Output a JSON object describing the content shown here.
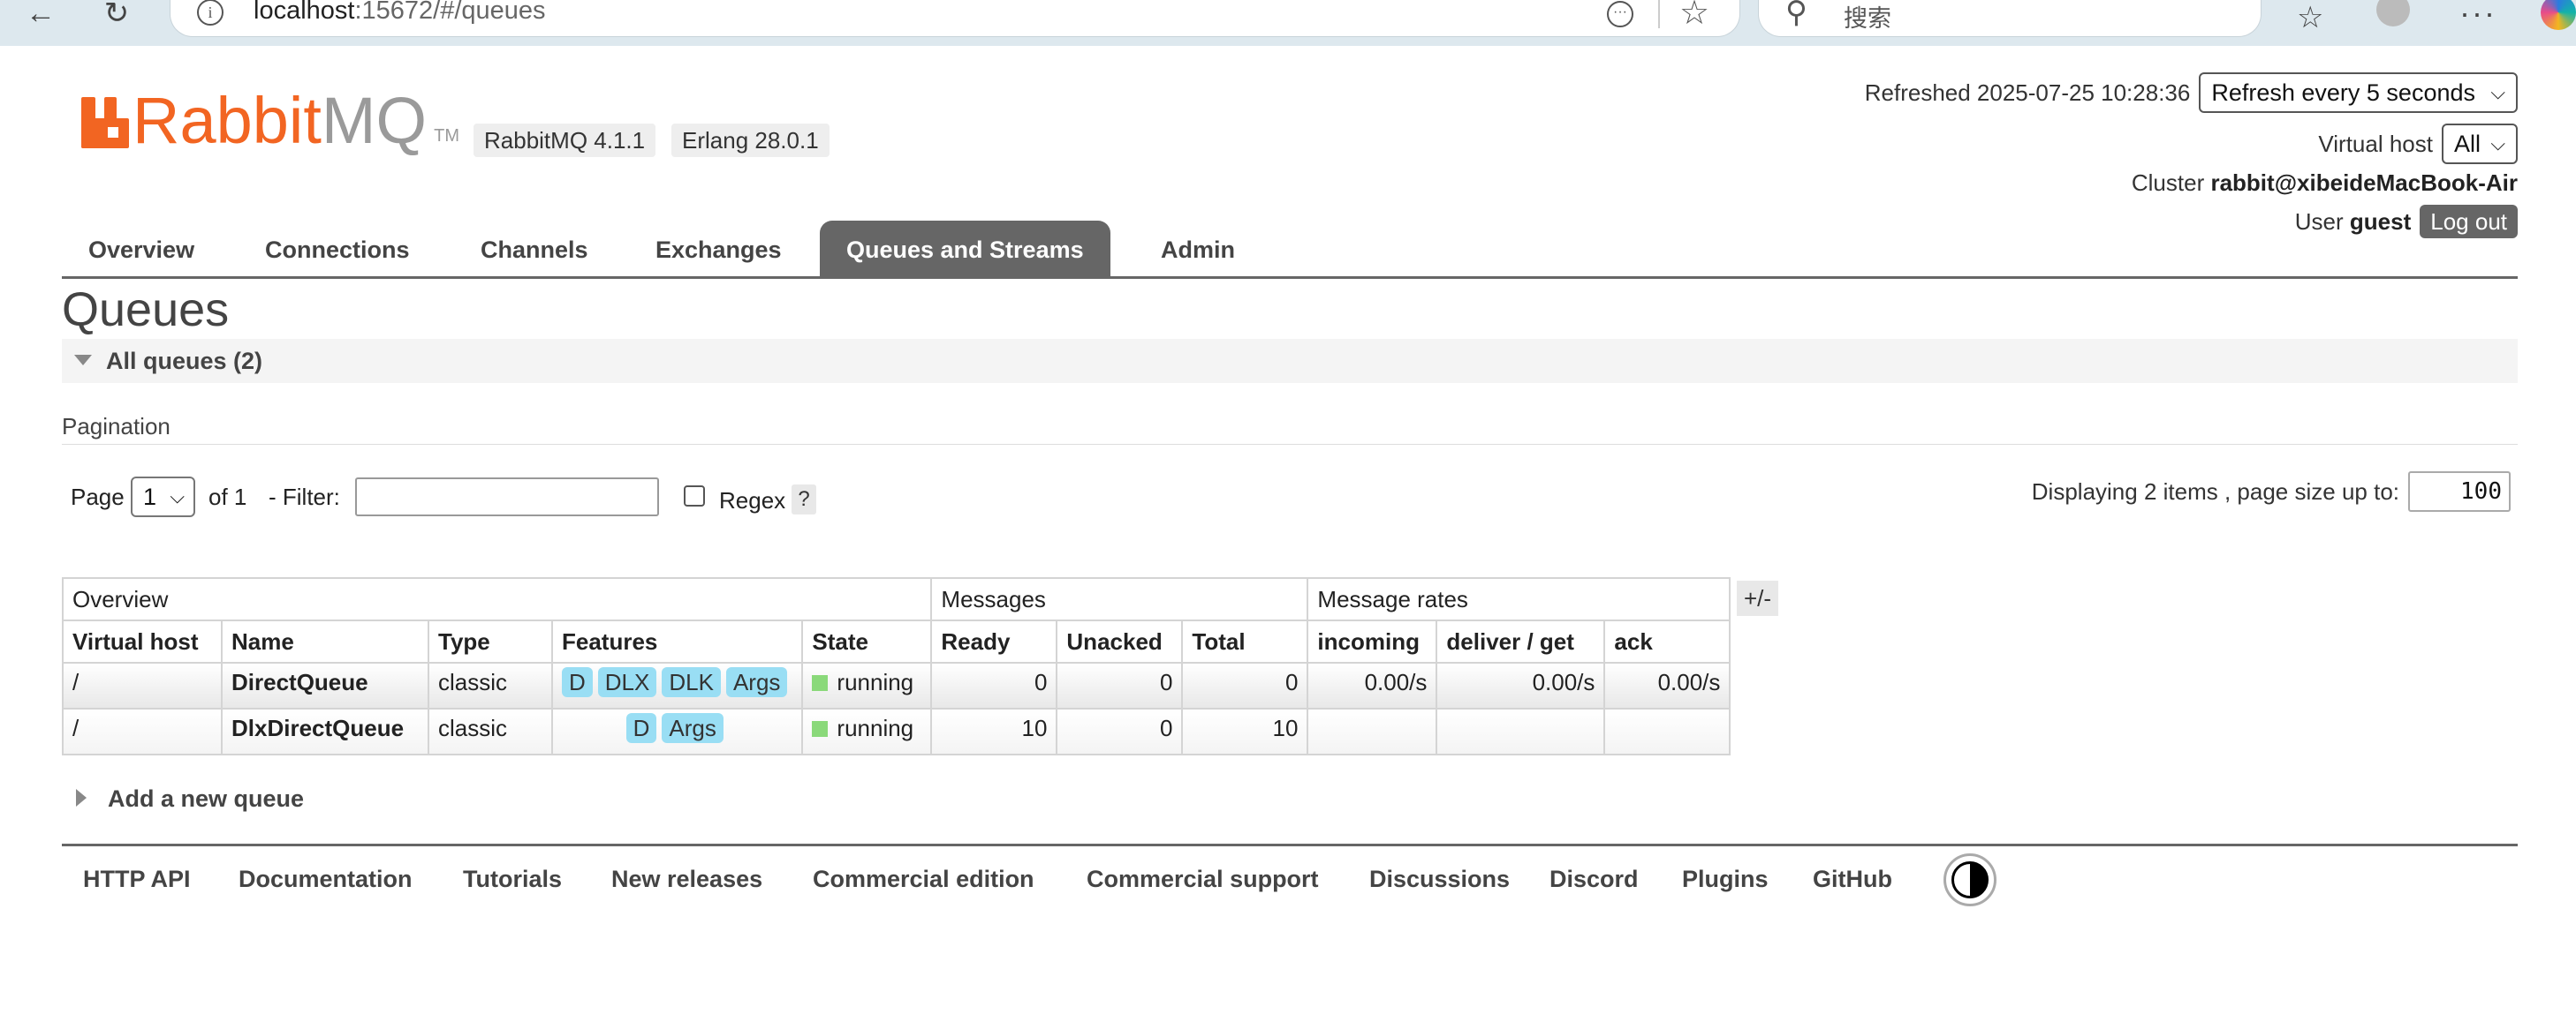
{
  "browser": {
    "url_host": "localhost",
    "url_rest": ":15672/#/queues",
    "search_placeholder": "搜索"
  },
  "header": {
    "logo_main": "Rabbit",
    "logo_mq": "MQ",
    "logo_tm": "TM",
    "version_rabbitmq": "RabbitMQ 4.1.1",
    "version_erlang": "Erlang 28.0.1",
    "refreshed_label": "Refreshed 2025-07-25 10:28:36",
    "refresh_select": "Refresh every 5 seconds",
    "vhost_label": "Virtual host",
    "vhost_select": "All",
    "cluster_label": "Cluster",
    "cluster_name": "rabbit@xibeideMacBook-Air",
    "user_label": "User",
    "user_name": "guest",
    "logout_label": "Log out"
  },
  "tabs": [
    "Overview",
    "Connections",
    "Channels",
    "Exchanges",
    "Queues and Streams",
    "Admin"
  ],
  "active_tab": "Queues and Streams",
  "page_title": "Queues",
  "section_label": "All queues (2)",
  "pagination": {
    "label": "Pagination",
    "page_label": "Page",
    "page_value": "1",
    "of_label": "of 1",
    "filter_label": "- Filter:",
    "regex_label": "Regex",
    "help_label": "?",
    "display_info": "Displaying 2 items , page size up to:",
    "page_size": "100"
  },
  "table": {
    "groups": [
      "Overview",
      "Messages",
      "Message rates"
    ],
    "columns": [
      "Virtual host",
      "Name",
      "Type",
      "Features",
      "State",
      "Ready",
      "Unacked",
      "Total",
      "incoming",
      "deliver / get",
      "ack"
    ],
    "toggle_label": "+/-",
    "rows": [
      {
        "vhost": "/",
        "name": "DirectQueue",
        "type": "classic",
        "features": [
          "D",
          "DLX",
          "DLK",
          "Args"
        ],
        "state": "running",
        "ready": "0",
        "unacked": "0",
        "total": "0",
        "incoming": "0.00/s",
        "deliver": "0.00/s",
        "ack": "0.00/s"
      },
      {
        "vhost": "/",
        "name": "DlxDirectQueue",
        "type": "classic",
        "features": [
          "D",
          "Args"
        ],
        "state": "running",
        "ready": "10",
        "unacked": "0",
        "total": "10",
        "incoming": "",
        "deliver": "",
        "ack": ""
      }
    ]
  },
  "add_queue_label": "Add a new queue",
  "footer_links": [
    "HTTP API",
    "Documentation",
    "Tutorials",
    "New releases",
    "Commercial edition",
    "Commercial support",
    "Discussions",
    "Discord",
    "Plugins",
    "GitHub"
  ],
  "colors": {
    "brand_orange": "#f26522",
    "tab_active": "#666666",
    "feature_tag": "#99def4",
    "state_running": "#8ad97a"
  }
}
